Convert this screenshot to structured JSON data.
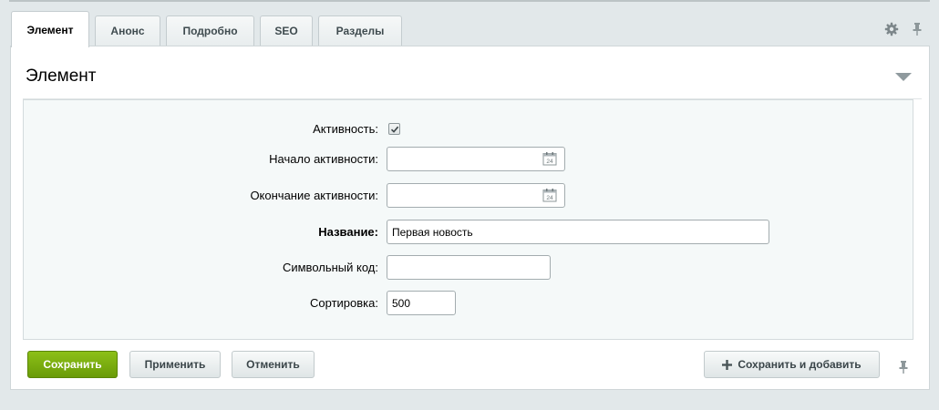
{
  "tabs": [
    {
      "label": "Элемент",
      "active": true
    },
    {
      "label": "Анонс"
    },
    {
      "label": "Подробно"
    },
    {
      "label": "SEO"
    },
    {
      "label": "Разделы"
    }
  ],
  "tab_tools": {
    "icons": [
      "gear-icon",
      "pin-icon"
    ]
  },
  "section": {
    "title": "Элемент"
  },
  "form": {
    "active_label": "Активность:",
    "active_checked": true,
    "start_label": "Начало активности:",
    "start_value": "",
    "end_label": "Окончание активности:",
    "end_value": "",
    "name_label": "Название:",
    "name_value": "Первая новость",
    "code_label": "Символьный код:",
    "code_value": "",
    "sort_label": "Сортировка:",
    "sort_value": "500",
    "calendar_day": "24"
  },
  "buttons": {
    "save": "Сохранить",
    "apply": "Применить",
    "cancel": "Отменить",
    "save_add": "Сохранить и добавить"
  },
  "colors": {
    "save_button": "#7aaf0f",
    "background": "#e2e8ea"
  }
}
